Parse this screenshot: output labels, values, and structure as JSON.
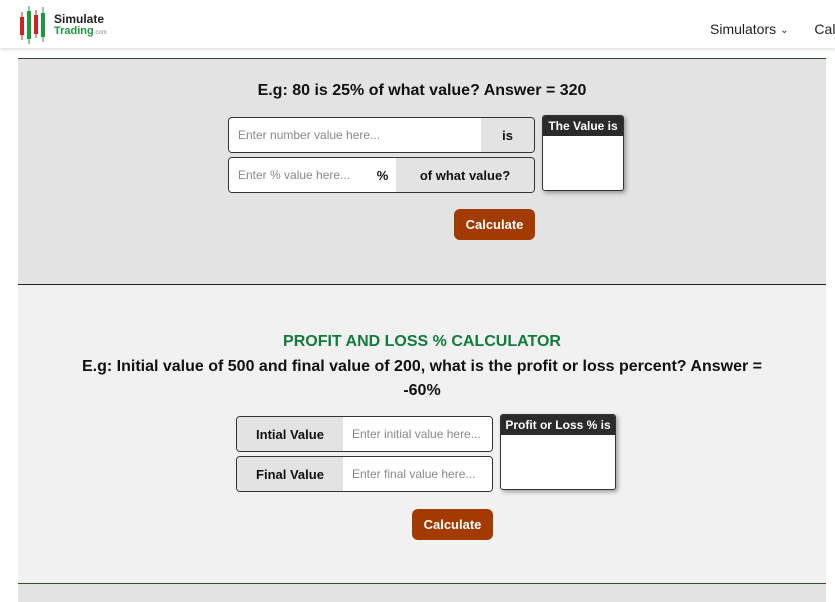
{
  "header": {
    "logo": {
      "line1": "Simulate",
      "line2": "Trading",
      "suffix": ".com"
    },
    "nav": [
      {
        "label": "Simulators",
        "has_dropdown": true
      },
      {
        "label": "Calc",
        "has_dropdown": false
      }
    ]
  },
  "percent_of_value_calc": {
    "example": "E.g: 80 is 25% of what value? Answer = 320",
    "number_input": {
      "value": "",
      "placeholder": "Enter number value here..."
    },
    "is_label": "is",
    "percent_input": {
      "value": "",
      "placeholder": "Enter % value here..."
    },
    "percent_symbol": "%",
    "of_what_label": "of what value?",
    "result_header": "The Value is",
    "result_value": "",
    "button_label": "Calculate"
  },
  "profit_loss_calc": {
    "title": "PROFIT AND LOSS % CALCULATOR",
    "example": "E.g: Initial value of 500 and final value of 200, what is the profit or loss percent? Answer = -60%",
    "initial_label": "Intial Value",
    "initial_input": {
      "value": "",
      "placeholder": "Enter initial value here..."
    },
    "final_label": "Final Value",
    "final_input": {
      "value": "",
      "placeholder": "Enter final value here..."
    },
    "result_header": "Profit or Loss % is",
    "result_value": "",
    "button_label": "Calculate"
  },
  "colors": {
    "accent_green": "#117a3d",
    "button": "#a33a00",
    "result_header_bg": "#2b2b2b"
  }
}
